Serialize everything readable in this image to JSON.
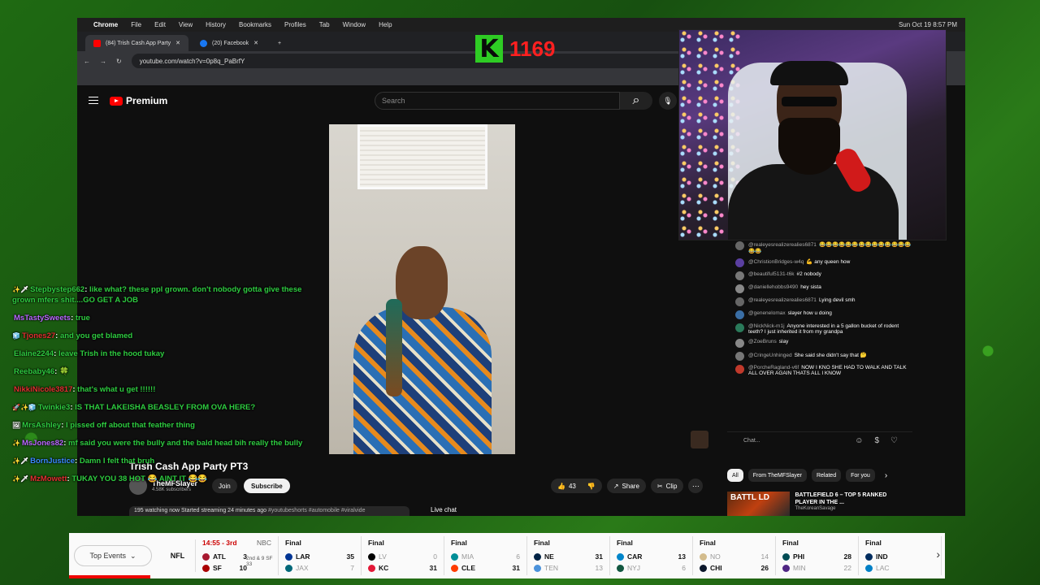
{
  "menubar": {
    "app": "Chrome",
    "items": [
      "File",
      "Edit",
      "View",
      "History",
      "Bookmarks",
      "Profiles",
      "Tab",
      "Window",
      "Help"
    ],
    "clock": "Sun Oct 19  8:57 PM"
  },
  "browser": {
    "tabs": [
      {
        "label": "(84) Trish Cash App Party",
        "color": "#ff0000"
      },
      {
        "label": "(20) Facebook",
        "color": "#1877f2"
      }
    ],
    "url": "youtube.com/watch?v=0p8q_PaBrfY"
  },
  "youtube": {
    "logo_text": "Premium",
    "search_placeholder": "Search",
    "video_title": "Trish Cash App Party PT3",
    "channel_name": "TheMFSlayer",
    "subscribers": "4.58K subscribers",
    "join_label": "Join",
    "subscribe_label": "Subscribe",
    "likes": "43",
    "share_label": "Share",
    "clip_label": "Clip",
    "desc_stats": "195 watching now  Started streaming 24 minutes ago",
    "desc_tags": "#youtubeshorts #automobile #viralvide",
    "live_chat_label": "Live chat",
    "chat_placeholder": "Chat...",
    "chips": [
      "All",
      "From TheMFSlayer",
      "Related",
      "For you"
    ],
    "rec_title": "BATTLEFIELD 6 – TOP 5 RANKED PLAYER IN THE ...",
    "rec_thumb_text": "BATTL  LD",
    "rec_channel": "TheKoreanSavage"
  },
  "yt_chat": [
    {
      "user": "@realeyesrealizerealies6871",
      "text": "😂😂😂😂😂😂😂😂😂😂😂😂😂😂😂😂",
      "color": "#666"
    },
    {
      "user": "@ChristionBridges-w4q",
      "text": "💪 any queen how",
      "color": "#5a3fa0"
    },
    {
      "user": "@beautiful5131-t6k",
      "text": "#2  nobody",
      "color": "#777"
    },
    {
      "user": "@daniellehobbs9490",
      "text": "hey sista",
      "color": "#888"
    },
    {
      "user": "@realeyesrealizerealies6871",
      "text": "Lying devil smh",
      "color": "#666"
    },
    {
      "user": "@genenelomax",
      "text": "slayer how u doing",
      "color": "#3a6ea5"
    },
    {
      "user": "@NickNick-m1j",
      "text": "Anyone interested in a 5 gallon bucket of rodent teeth? I just inherited it from my grandpa",
      "color": "#2a7a5a"
    },
    {
      "user": "@ZoeBruns",
      "text": "slay",
      "color": "#888"
    },
    {
      "user": "@CringeUnhinged",
      "text": "She said she didn't say that 🤔",
      "color": "#777"
    },
    {
      "user": "@PorcheRagland-v6f",
      "text": "NOW I KNO SHE HAD TO WALK AND TALK ALL OVER AGAIN THATS ALL I KNOW",
      "color": "#c0392b"
    }
  ],
  "counter": {
    "letter": "K",
    "value": "1169"
  },
  "twitch_chat": [
    {
      "badge": "✨🗡",
      "user": "Stepbystep662",
      "user_color": "#2ecc40",
      "text": "like what? these ppl grown. don't nobody gotta give these grown mfers shit....GO GET A JOB",
      "text_color": "#2ecc40"
    },
    {
      "badge": "",
      "user": "MsTastySweets",
      "user_color": "#b967ff",
      "text": "true",
      "text_color": "#2ecc40"
    },
    {
      "badge": "🧊",
      "user": "Tjones27",
      "user_color": "#e03030",
      "text": "and you get blamed",
      "text_color": "#2ecc40"
    },
    {
      "badge": "",
      "user": "Elaine2244",
      "user_color": "#2ecc40",
      "text": "leave Trish in the hood tukay",
      "text_color": "#2ecc40"
    },
    {
      "badge": "",
      "user": "Reebaby46",
      "user_color": "#2ecc40",
      "text": "🍀",
      "text_color": "#2ecc40"
    },
    {
      "badge": "",
      "user": "NikkiNicole3817",
      "user_color": "#e03030",
      "text": "that's what u get !!!!!!",
      "text_color": "#2ecc40"
    },
    {
      "badge": "🚀✨🧊",
      "user": "Twinkie3",
      "user_color": "#2ecc40",
      "text": "IS THAT LAKEISHA BEASLEY FROM OVA HERE?",
      "text_color": "#2ecc40"
    },
    {
      "badge": "🖼",
      "user": "MrsAshley",
      "user_color": "#2ecc40",
      "text": "I pissed off about that feather thing",
      "text_color": "#2ecc40"
    },
    {
      "badge": "✨",
      "user": "MsJones82",
      "user_color": "#b967ff",
      "text": "mf said you were the bully and the bald head bih really the bully",
      "text_color": "#2ecc40"
    },
    {
      "badge": "✨🗡",
      "user": "BornJustice",
      "user_color": "#3b8bff",
      "text": "Damn I felt that bruh",
      "text_color": "#2ecc40"
    },
    {
      "badge": "✨🗡",
      "user": "MzMowett",
      "user_color": "#e03030",
      "text": "TUKAY YOU 38 HOT 😂 AINT IT 😂😂",
      "text_color": "#2ecc40"
    }
  ],
  "ticker": {
    "top_events_label": "Top Events",
    "league": "NFL",
    "games": [
      {
        "status": "14:55 - 3rd",
        "net": "NBC",
        "down": "2nd & 9  SF 33",
        "t1": "ATL",
        "s1": "3",
        "t2": "SF",
        "s2": "10",
        "c1": "#a71930",
        "c2": "#aa0000",
        "win": 0
      },
      {
        "status": "Final",
        "net": "",
        "t1": "LAR",
        "s1": "35",
        "t2": "JAX",
        "s2": "7",
        "c1": "#003594",
        "c2": "#006778",
        "win": 1
      },
      {
        "status": "Final",
        "net": "",
        "t1": "LV",
        "s1": "0",
        "t2": "KC",
        "s2": "31",
        "c1": "#000000",
        "c2": "#e31837",
        "win": 2
      },
      {
        "status": "Final",
        "net": "",
        "t1": "MIA",
        "s1": "6",
        "t2": "CLE",
        "s2": "31",
        "c1": "#008e97",
        "c2": "#ff3c00",
        "win": 2
      },
      {
        "status": "Final",
        "net": "",
        "t1": "NE",
        "s1": "31",
        "t2": "TEN",
        "s2": "13",
        "c1": "#002244",
        "c2": "#4b92db",
        "win": 1
      },
      {
        "status": "Final",
        "net": "",
        "t1": "CAR",
        "s1": "13",
        "t2": "NYJ",
        "s2": "6",
        "c1": "#0085ca",
        "c2": "#125740",
        "win": 1
      },
      {
        "status": "Final",
        "net": "",
        "t1": "NO",
        "s1": "14",
        "t2": "CHI",
        "s2": "26",
        "c1": "#d3bc8d",
        "c2": "#0b162a",
        "win": 2
      },
      {
        "status": "Final",
        "net": "",
        "t1": "PHI",
        "s1": "28",
        "t2": "MIN",
        "s2": "22",
        "c1": "#004c54",
        "c2": "#4f2683",
        "win": 1
      },
      {
        "status": "Final",
        "net": "",
        "t1": "IND",
        "s1": "",
        "t2": "LAC",
        "s2": "",
        "c1": "#002c5f",
        "c2": "#0080c6",
        "win": 1
      }
    ]
  }
}
